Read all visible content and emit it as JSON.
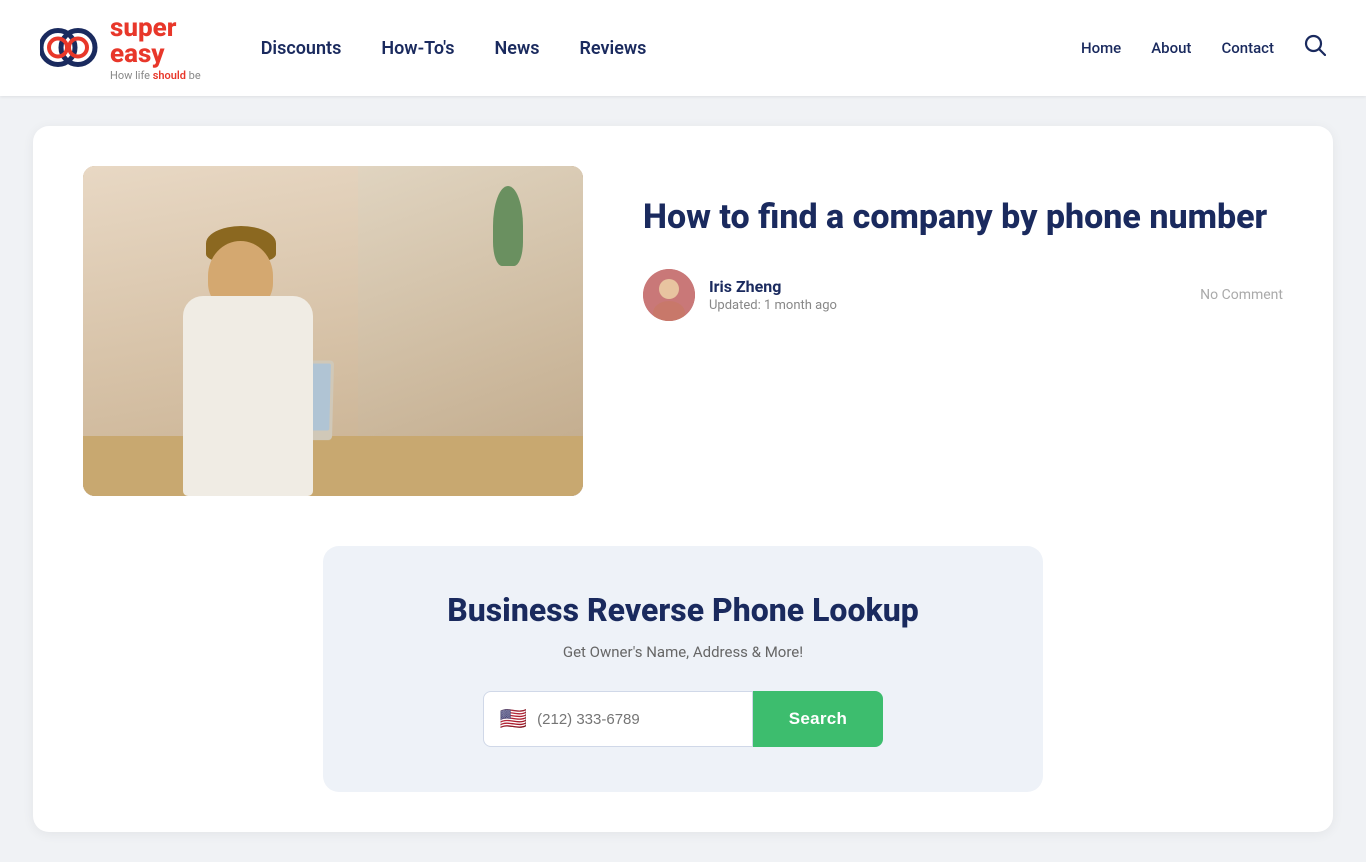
{
  "header": {
    "logo": {
      "brand_part1": "super",
      "brand_part2": "easy",
      "tagline_before": "How life ",
      "tagline_em": "should",
      "tagline_after": " be"
    },
    "nav_main": [
      {
        "label": "Discounts",
        "href": "#"
      },
      {
        "label": "How-To's",
        "href": "#"
      },
      {
        "label": "News",
        "href": "#"
      },
      {
        "label": "Reviews",
        "href": "#"
      }
    ],
    "nav_right": [
      {
        "label": "Home",
        "href": "#"
      },
      {
        "label": "About",
        "href": "#"
      },
      {
        "label": "Contact",
        "href": "#"
      }
    ]
  },
  "article": {
    "title": "How to find a company by phone number",
    "author_name": "Iris Zheng",
    "updated": "Updated: 1 month ago",
    "no_comment": "No Comment"
  },
  "widget": {
    "title": "Business Reverse Phone Lookup",
    "subtitle": "Get Owner's Name, Address & More!",
    "phone_placeholder": "(212) 333-6789",
    "search_label": "Search"
  }
}
